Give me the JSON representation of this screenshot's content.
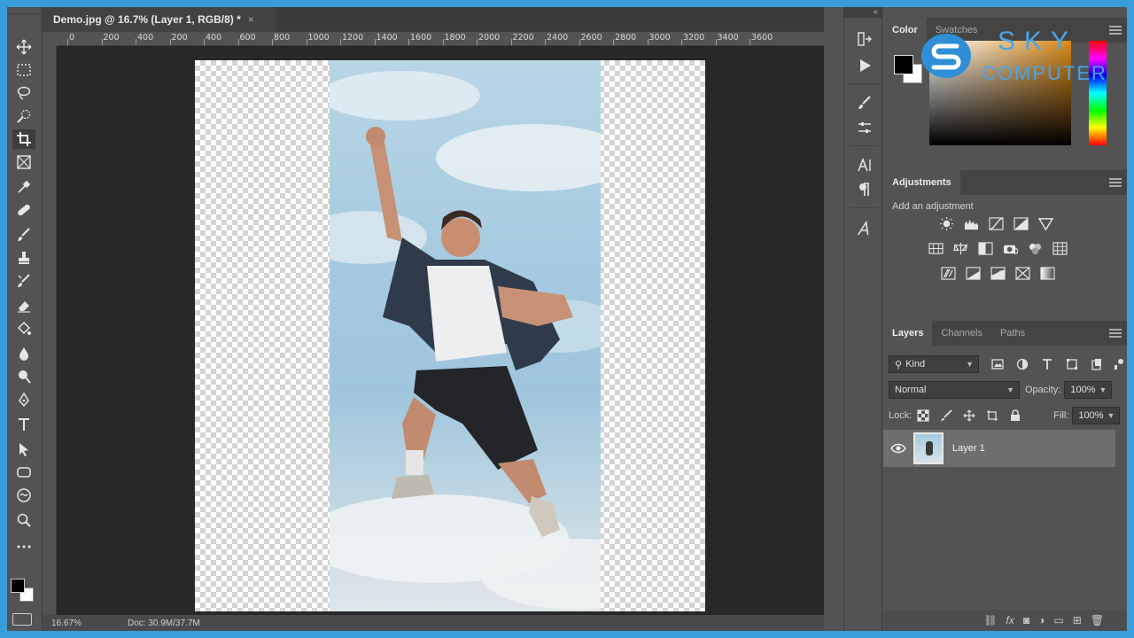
{
  "document": {
    "tab_title": "Demo.jpg @ 16.7% (Layer 1, RGB/8) *",
    "close_glyph": "×",
    "ruler_labels": [
      "0",
      "200",
      "400",
      "200",
      "400",
      "600",
      "800",
      "1000",
      "1200",
      "1400",
      "1600",
      "1800",
      "2000",
      "2200",
      "2400",
      "2600",
      "2800",
      "3000",
      "3200",
      "3400",
      "3600"
    ],
    "status_zoom": "16.67%",
    "status_doc": "Doc: 30.9M/37.7M"
  },
  "panels": {
    "collapse_glyph": "«",
    "color_tabs": [
      "Color",
      "Swatches"
    ],
    "adjustments_tab": "Adjustments",
    "adjustments_hint": "Add an adjustment",
    "layers_tabs": [
      "Layers",
      "Channels",
      "Paths"
    ],
    "filter_kind": "Kind",
    "blend_mode": "Normal",
    "opacity_label": "Opacity:",
    "opacity_value": "100%",
    "lock_label": "Lock:",
    "fill_label": "Fill:",
    "fill_value": "100%",
    "layer_name": "Layer 1"
  },
  "watermark": {
    "line1": "SKY",
    "line2": "COMPUTER",
    "color": "#4aa4e8"
  },
  "colors": {
    "foreground": "#000000",
    "background": "#ffffff",
    "canvas_bg": "#282828",
    "ui_panel": "#535353"
  }
}
